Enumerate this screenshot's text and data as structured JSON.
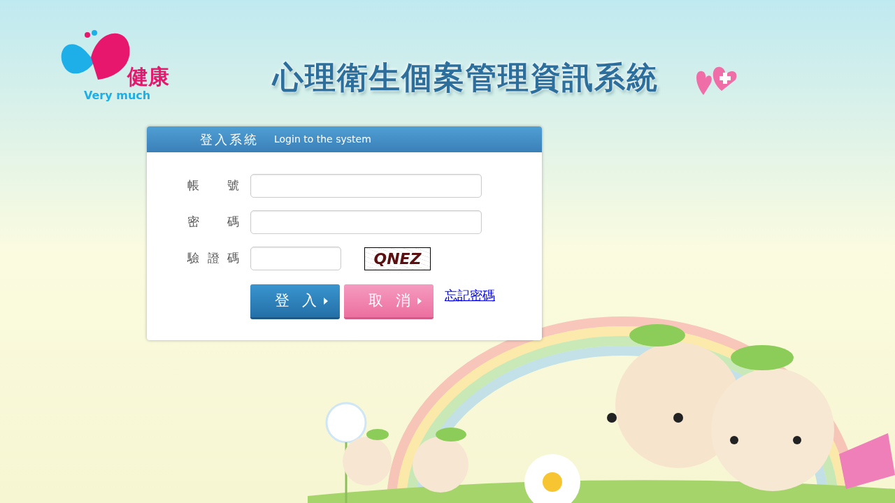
{
  "logo": {
    "text": "健康",
    "tagline": "Very much"
  },
  "title": "心理衛生個案管理資訊系統",
  "login_panel": {
    "title": "登入系統",
    "subtitle": "Login to the system",
    "fields": [
      {
        "label": "帳號",
        "kind": "text"
      },
      {
        "label": "密碼",
        "kind": "password"
      },
      {
        "label": "驗證碼",
        "kind": "captcha",
        "captcha": "QNEZ"
      }
    ],
    "buttons": [
      {
        "label": "登入",
        "kind": "primary"
      },
      {
        "label": "取消",
        "kind": "secondary"
      }
    ],
    "forgot_link": "忘記密碼"
  }
}
